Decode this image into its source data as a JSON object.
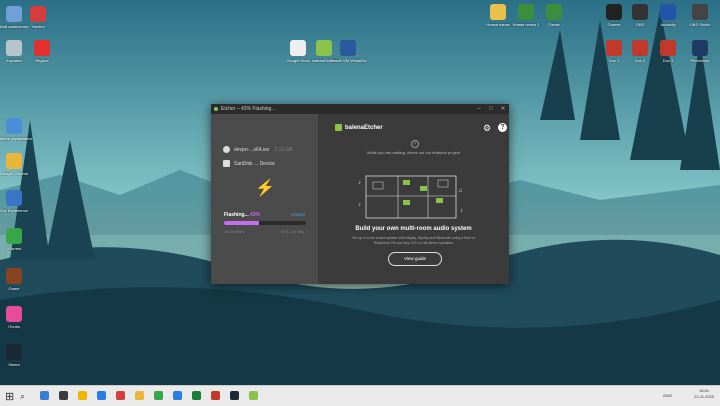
{
  "desktop": {
    "icons_left": [
      {
        "label": "Мой компьютер",
        "color": "#6fa0d8"
      },
      {
        "label": "Yandex",
        "color": "#d63e3e"
      },
      {
        "label": "Корзина",
        "color": "#b8c4cc"
      },
      {
        "label": "Яндекс",
        "color": "#e03030"
      },
      {
        "label": "Панель управления",
        "color": "#4a8fd6"
      },
      {
        "label": "Google Chrome",
        "color": "#e9b53b"
      },
      {
        "label": "Our Experience",
        "color": "#3a75c4"
      },
      {
        "label": "uTorrent",
        "color": "#3aa64a"
      },
      {
        "label": "Game",
        "color": "#884422"
      },
      {
        "label": "iTunes",
        "color": "#e74c9b"
      },
      {
        "label": "Steam",
        "color": "#1b2838"
      }
    ],
    "icons_center": [
      {
        "label": "Google Docs",
        "color": "#eeeeee"
      },
      {
        "label": "balenaEtcher",
        "color": "#8bc34a"
      },
      {
        "label": "Oracle VM VirtualBox",
        "color": "#2a5a9c"
      }
    ],
    "icons_right": [
      {
        "label": "Новая папка",
        "color": "#e8c14a"
      },
      {
        "label": "Новая папка 2",
        "color": "#3c8d3c"
      },
      {
        "label": "Папка",
        "color": "#3c8d3c"
      },
      {
        "label": "Games",
        "color": "#222222"
      },
      {
        "label": "OBS",
        "color": "#333333"
      },
      {
        "label": "Audacity",
        "color": "#2255aa"
      },
      {
        "label": "OBS Studio",
        "color": "#444444"
      },
      {
        "label": "Doc 1",
        "color": "#c0392b"
      },
      {
        "label": "Doc 2",
        "color": "#c0392b"
      },
      {
        "label": "Doc 3",
        "color": "#c0392b"
      },
      {
        "label": "Photoshop",
        "color": "#1f3a63"
      }
    ]
  },
  "etcher": {
    "title": "Etcher – 43% Flashing...",
    "image_name": "devpn-...x64.iso",
    "image_size": "2.12 GB",
    "drive_name": "SanDisk ... Device",
    "flash_label": "Flashing...",
    "flash_percent": "43%",
    "progress": 0.43,
    "cancel_label": "Cancel",
    "speed": "16.39 MB/s",
    "eta": "ETA: 2m 30s",
    "logo_text": "balenaEtcher",
    "promo_top": "While you are waiting, check out our featured project",
    "headline": "Build your own multi-room audio system",
    "subtext": "Set up a home sound system with Airplay, Spotify and Bluetooth using a fleet of Raspberry Pis and any Hi-Fi or old stereo speakers",
    "view_button": "View guide"
  },
  "taskbar": {
    "lang": "ENG",
    "time": "18:51",
    "date": "22.11.2020",
    "pinned_colors": [
      "#3b7bd4",
      "#3b3b3b",
      "#f0b400",
      "#2a7de1",
      "#d63e3e",
      "#e9b53b",
      "#3aa64a",
      "#2a7de1",
      "#1b7d3b",
      "#c0392b",
      "#1b2838",
      "#8bc34a"
    ]
  }
}
